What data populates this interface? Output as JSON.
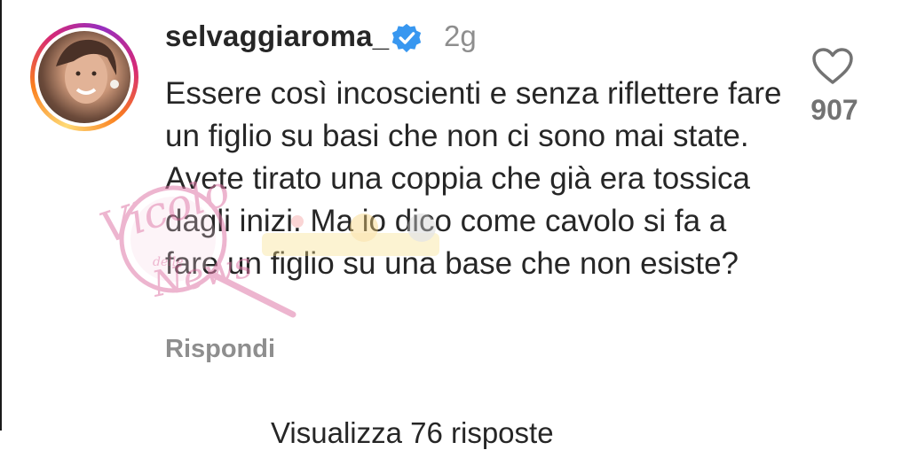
{
  "comment": {
    "username": "selvaggiaroma_",
    "verified": true,
    "time": "2g",
    "text": "Essere così incoscienti e senza riflettere fare un figlio su basi che non ci sono mai state. Avete tirato una coppia che già era tossica dagli inizi. Ma io dico come cavolo si fa a fare un figlio su una base che non esiste?",
    "reply_label": "Rispondi",
    "like_count": "907"
  },
  "more_replies": "Visualizza 76 risposte",
  "watermark": {
    "line1": "Vicolo",
    "line2": "delle",
    "line3": "News"
  },
  "colors": {
    "verified": "#3897f0",
    "secondary_text": "#8e8e8e",
    "like_count": "#737373",
    "watermark": "#e07aa8"
  },
  "icons": {
    "verified": "verified-badge-icon",
    "like": "heart-outline-icon"
  }
}
